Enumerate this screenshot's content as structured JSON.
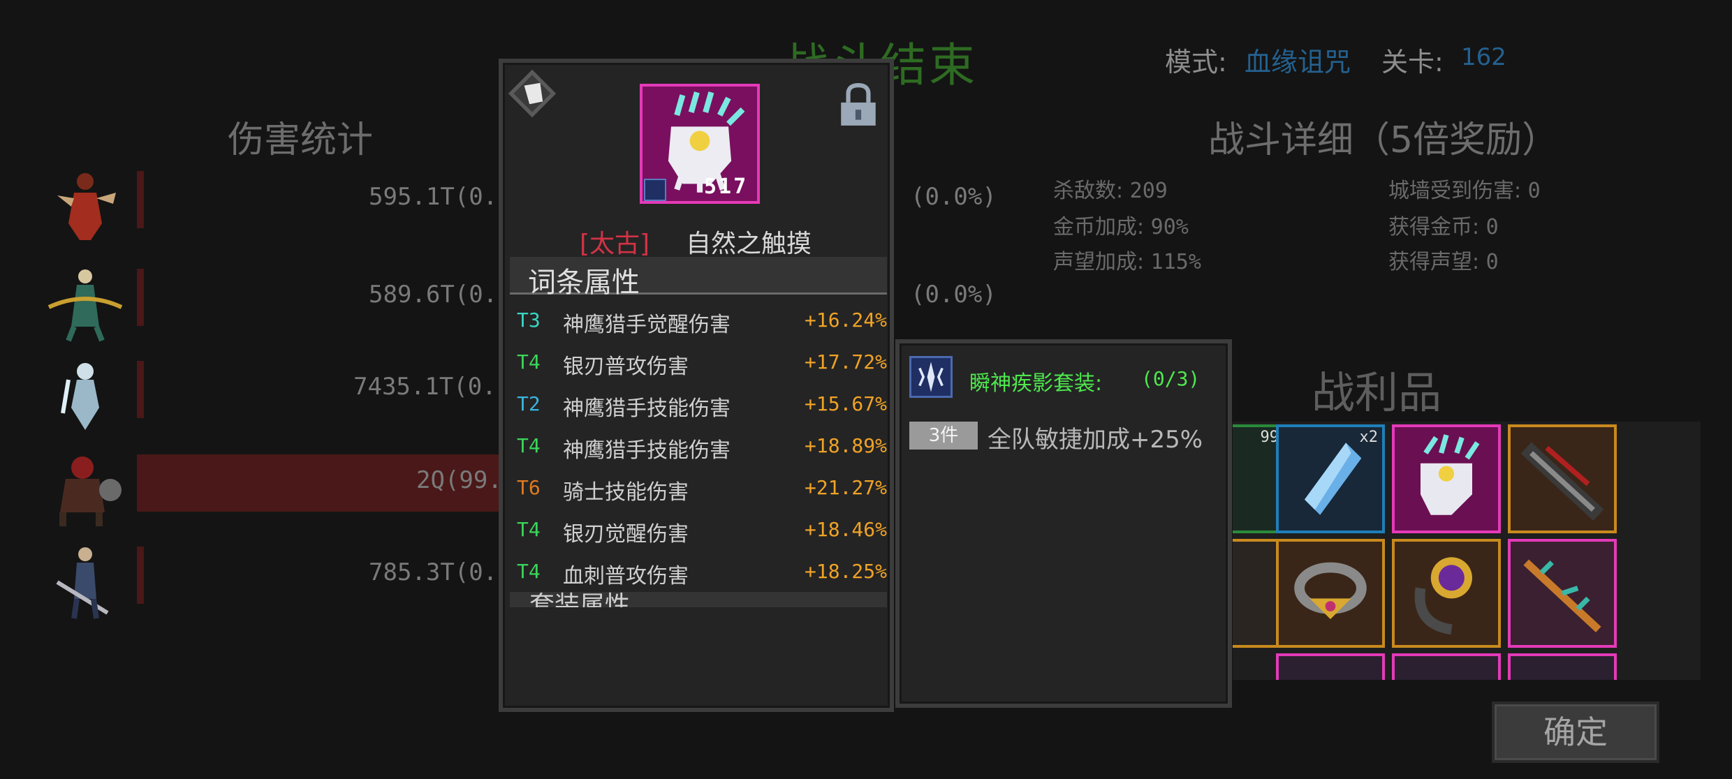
{
  "header": {
    "title": "战斗结束",
    "mode_label": "模式:",
    "mode_value": "血缘诅咒",
    "stage_label": "关卡:",
    "stage_value": "162"
  },
  "damage": {
    "title": "伤害统计",
    "heroes": [
      {
        "value": "595.1T(0.",
        "pct": "(0.0%)",
        "bar_fraction": 0.0,
        "icon": "hero-red-warrior-icon"
      },
      {
        "value": "589.6T(0.",
        "pct": "(0.0%)",
        "bar_fraction": 0.0,
        "icon": "hero-archer-icon"
      },
      {
        "value": "7435.1T(0.",
        "pct": "",
        "bar_fraction": 0.0,
        "icon": "hero-mage-icon"
      },
      {
        "value": "2Q(99.",
        "pct": "",
        "bar_fraction": 0.997,
        "icon": "hero-berserker-icon"
      },
      {
        "value": "785.3T(0.",
        "pct": "",
        "bar_fraction": 0.0,
        "icon": "hero-swordsman-icon"
      }
    ]
  },
  "detail": {
    "title": "战斗详细（5倍奖励）",
    "stats": [
      {
        "label": "杀敌数:",
        "value": "209"
      },
      {
        "label": "城墙受到伤害:",
        "value": "0"
      },
      {
        "label": "金币加成:",
        "value": "90%"
      },
      {
        "label": "获得金币:",
        "value": "0"
      },
      {
        "label": "声望加成:",
        "value": "115%"
      },
      {
        "label": "获得声望:",
        "value": "0"
      }
    ]
  },
  "loot": {
    "title": "战利品",
    "confirm_label": "确定",
    "items": [
      {
        "icon": "crystal-shard-icon",
        "count": "x2",
        "border": "#1f7fb8"
      },
      {
        "icon": "feather-claw-icon",
        "count": "",
        "border": "#e43ab8"
      },
      {
        "icon": "crossbow-icon",
        "count": "",
        "border": "#c88a1e"
      },
      {
        "icon": "gold-ring-icon",
        "count": "",
        "border": "#c88a1e"
      },
      {
        "icon": "purple-gem-ring-icon",
        "count": "",
        "border": "#c88a1e"
      },
      {
        "icon": "thorn-bow-icon",
        "count": "",
        "border": "#e43ab8"
      }
    ],
    "partial_count": "99"
  },
  "item": {
    "level": "517",
    "name_prefix": "[太古]",
    "name": "自然之触摸",
    "affix_section_title": "词条属性",
    "next_section_title": "套装属性",
    "affixes": [
      {
        "tier": "T3",
        "tier_color": "#3ad6c4",
        "name": "神鹰猎手觉醒伤害",
        "value": "+16.24%"
      },
      {
        "tier": "T4",
        "tier_color": "#3ad65a",
        "name": "银刃普攻伤害",
        "value": "+17.72%"
      },
      {
        "tier": "T2",
        "tier_color": "#3ab4e0",
        "name": "神鹰猎手技能伤害",
        "value": "+15.67%"
      },
      {
        "tier": "T4",
        "tier_color": "#3ad65a",
        "name": "神鹰猎手技能伤害",
        "value": "+18.89%"
      },
      {
        "tier": "T6",
        "tier_color": "#e07a1e",
        "name": "骑士技能伤害",
        "value": "+21.27%"
      },
      {
        "tier": "T4",
        "tier_color": "#3ad65a",
        "name": "银刃觉醒伤害",
        "value": "+18.46%"
      },
      {
        "tier": "T4",
        "tier_color": "#3ad65a",
        "name": "血刺普攻伤害",
        "value": "+18.25%"
      }
    ]
  },
  "set": {
    "name": "瞬神疾影套装:",
    "count": "(0/3)",
    "badge": "3件",
    "bonus": "全队敏捷加成+25%"
  }
}
